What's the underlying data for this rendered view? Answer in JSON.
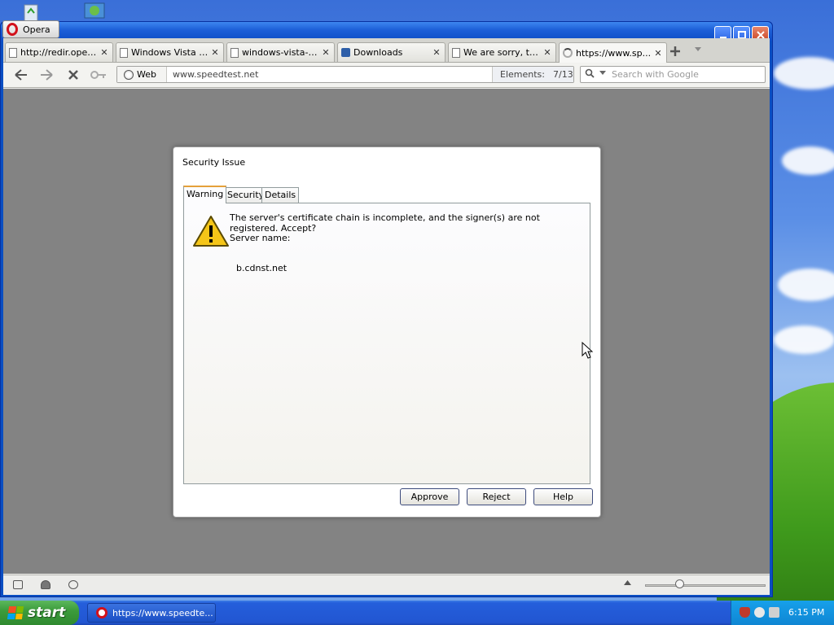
{
  "opera_menu_label": "Opera",
  "tabs": [
    {
      "label": "http://redir.oper...",
      "icon": "page-icon"
    },
    {
      "label": "Windows Vista Ul...",
      "icon": "page-icon"
    },
    {
      "label": "windows-vista-ul...",
      "icon": "page-icon"
    },
    {
      "label": "Downloads",
      "icon": "download-icon"
    },
    {
      "label": "We are sorry, th...",
      "icon": "page-icon"
    },
    {
      "label": "https://www.sp...",
      "icon": "loading-icon",
      "active": true
    }
  ],
  "tab_close": "✕",
  "navbar": {
    "web_label": "Web",
    "url": "www.speedtest.net",
    "elements_label": "Elements:",
    "elements_count": "7/13",
    "search_placeholder": "Search with Google"
  },
  "dialog": {
    "title": "Security Issue",
    "tabs": [
      "Warning",
      "Security",
      "Details"
    ],
    "message": "The server's certificate chain is incomplete, and the signer(s) are not registered. Accept?",
    "server_label": "Server name:",
    "server_name": "b.cdnst.net",
    "buttons": {
      "approve": "Approve",
      "reject": "Reject",
      "help": "Help"
    }
  },
  "taskbar": {
    "start_label": "start",
    "task_item": "https://www.speedte...",
    "clock": "6:15 PM"
  },
  "colors": {
    "xp_blue": "#0a4ec2",
    "start_green": "#3c9c3c",
    "content_gray": "#838383",
    "warning_yellow": "#f5c518",
    "opera_red": "#d2111b"
  }
}
